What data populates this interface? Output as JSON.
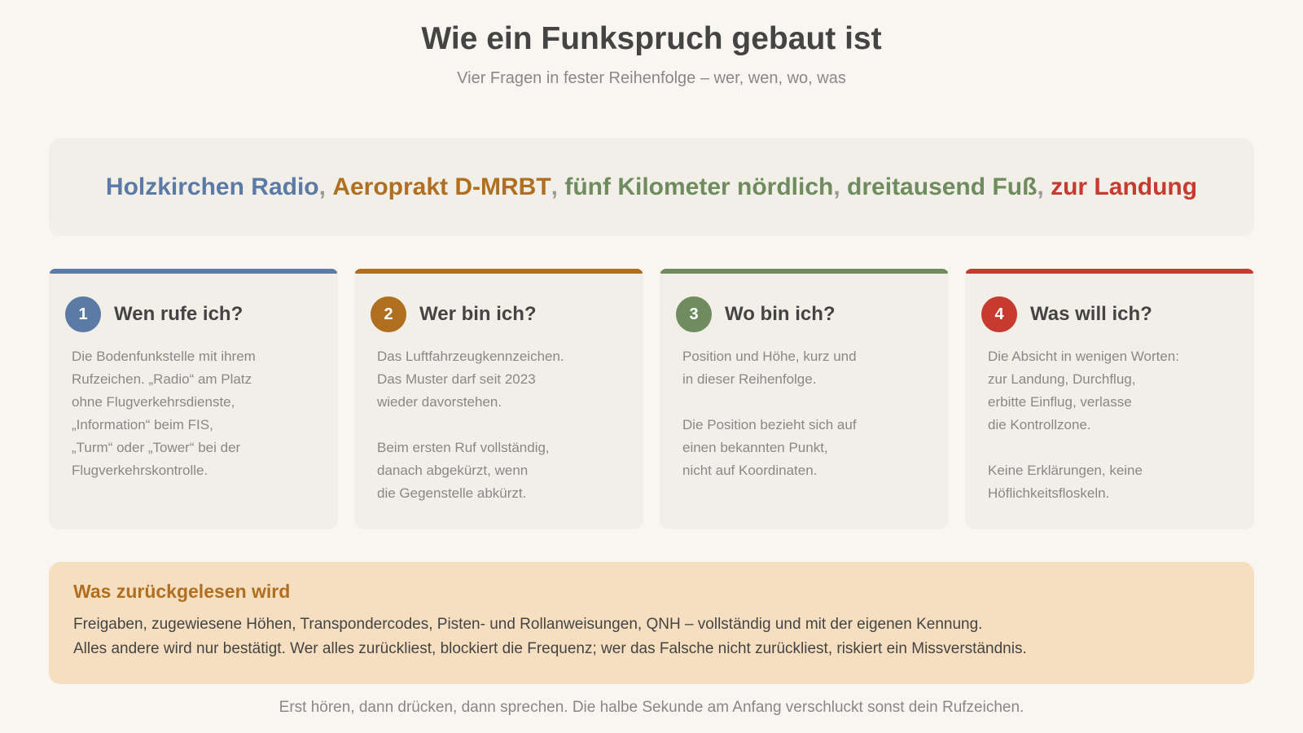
{
  "header": {
    "title": "Wie ein Funkspruch gebaut ist",
    "subtitle": "Vier Fragen in fester Reihenfolge – wer, wen, wo, was"
  },
  "colors": {
    "blue": "#5b7ba6",
    "amber": "#b06f20",
    "green": "#6e8c5e",
    "red": "#c63a30"
  },
  "example": {
    "part1": "Holzkirchen Radio",
    "part2": "Aeroprakt D-MRBT",
    "part3": "fünf Kilometer nördlich",
    "part4": "dreitausend Fuß",
    "part5": "zur Landung",
    "separator": ","
  },
  "cards": [
    {
      "number": "1",
      "title": "Wen rufe ich?",
      "body": "Die Bodenfunkstelle mit ihrem\nRufzeichen. „Radio“ am Platz\nohne Flugverkehrsdienste,\n„Information“ beim FIS,\n„Turm“ oder „Tower“ bei der\nFlugverkehrskontrolle."
    },
    {
      "number": "2",
      "title": "Wer bin ich?",
      "body": "Das Luftfahrzeugkennzeichen.\nDas Muster darf seit 2023\nwieder davorstehen.\n\nBeim ersten Ruf vollständig,\ndanach abgekürzt, wenn\ndie Gegenstelle abkürzt."
    },
    {
      "number": "3",
      "title": "Wo bin ich?",
      "body": "Position und Höhe, kurz und\nin dieser Reihenfolge.\n\nDie Position bezieht sich auf\neinen bekannten Punkt,\nnicht auf Koordinaten."
    },
    {
      "number": "4",
      "title": "Was will ich?",
      "body": "Die Absicht in wenigen Worten:\nzur Landung, Durchflug,\nerbitte Einflug, verlasse\ndie Kontrollzone.\n\nKeine Erklärungen, keine\nHöflichkeitsfloskeln."
    }
  ],
  "note": {
    "title": "Was zurückgelesen wird",
    "line1": "Freigaben, zugewiesene Höhen, Transpondercodes, Pisten- und Rollanweisungen, QNH – vollständig und mit der eigenen Kennung.",
    "line2": "Alles andere wird nur bestätigt. Wer alles zurückliest, blockiert die Frequenz; wer das Falsche nicht zurückliest, riskiert ein Missverständnis."
  },
  "footer": "Erst hören, dann drücken, dann sprechen. Die halbe Sekunde am Anfang verschluckt sonst dein Rufzeichen."
}
